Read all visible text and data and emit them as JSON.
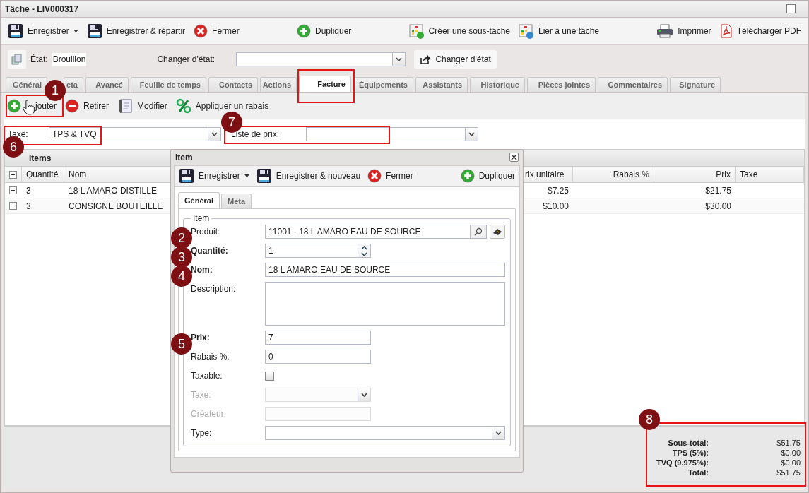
{
  "window": {
    "title": "Tâche - LIV000317"
  },
  "toolbar": [
    [
      {
        "kind": "save",
        "label": "Enregistrer",
        "dropdown": true
      },
      {
        "kind": "save-send",
        "label": "Enregistrer & répartir"
      },
      {
        "kind": "close",
        "label": "Fermer"
      }
    ],
    [
      {
        "kind": "duplicate",
        "label": "Dupliquer"
      }
    ],
    [
      {
        "kind": "subtask",
        "label": "Créer une sous-tâche"
      },
      {
        "kind": "link",
        "label": "Lier à une tâche"
      }
    ],
    [
      {
        "kind": "print",
        "label": "Imprimer"
      },
      {
        "kind": "pdf",
        "label": "Télécharger PDF"
      }
    ]
  ],
  "state": {
    "label": "État:",
    "value": "Brouillon",
    "change_label": "Changer d'état:",
    "change_button": "Changer d'état"
  },
  "tabs": [
    {
      "label": "Général",
      "selected": false
    },
    {
      "label": "eta",
      "selected": false
    },
    {
      "label": "Avancé",
      "selected": false
    },
    {
      "label": "Feuille de temps",
      "selected": false
    },
    {
      "label": "Contacts",
      "selected": false
    },
    {
      "label": "Actions",
      "selected": false
    },
    {
      "label": "Facture",
      "selected": true
    },
    {
      "label": "Équipements",
      "selected": false
    },
    {
      "label": "Assistants",
      "selected": false
    },
    {
      "label": "Historique",
      "selected": false
    },
    {
      "label": "Pièces jointes",
      "selected": false
    },
    {
      "label": "Commentaires",
      "selected": false
    },
    {
      "label": "Signature",
      "selected": false
    }
  ],
  "subtoolbar": [
    {
      "kind": "add",
      "label": "jouter"
    },
    {
      "kind": "remove",
      "label": "Retirer"
    },
    {
      "kind": "edit",
      "label": "Modifier"
    },
    {
      "kind": "discount",
      "label": "Appliquer un rabais"
    }
  ],
  "filters": {
    "tax_label": "Taxe:",
    "tax_value": "TPS & TVQ",
    "pricelist_label": "Liste de prix:"
  },
  "items": {
    "title": "Items",
    "columns": [
      "Quantité",
      "Nom",
      "rix unitaire",
      "Rabais %",
      "Prix",
      "Taxe"
    ],
    "rows": [
      {
        "quantity": "3",
        "name": "18 L AMARO DISTILLE",
        "unit_price": "$7.25",
        "price": "$21.75"
      },
      {
        "quantity": "3",
        "name": "CONSIGNE BOUTEILLE",
        "unit_price": "$10.00",
        "price": "$30.00"
      }
    ]
  },
  "totals": [
    {
      "label": "Sous-total:",
      "value": "$51.75"
    },
    {
      "label": "TPS (5%):",
      "value": "$0.00"
    },
    {
      "label": "TVQ (9.975%):",
      "value": "$0.00"
    },
    {
      "label": "Total:",
      "value": "$51.75"
    }
  ],
  "dialog": {
    "title": "Item",
    "toolbar": [
      {
        "kind": "save",
        "label": "Enregistrer",
        "dropdown": true
      },
      {
        "kind": "save",
        "label": "Enregistrer & nouveau"
      },
      {
        "kind": "close",
        "label": "Fermer"
      },
      {
        "kind": "duplicate",
        "label": "Dupliquer"
      }
    ],
    "tabs": [
      {
        "label": "Général",
        "selected": true
      },
      {
        "label": "Meta",
        "selected": false
      }
    ],
    "legend": "Item",
    "fields": [
      {
        "kind": "lookup",
        "label": "Produit:",
        "value": "11001 - 18 L AMARO EAU DE SOURCE",
        "required": false
      },
      {
        "kind": "spinner",
        "label": "Quantité:",
        "value": "1",
        "required": true
      },
      {
        "kind": "text",
        "label": "Nom:",
        "value": "18 L AMARO EAU DE SOURCE",
        "required": true,
        "wide": true
      },
      {
        "kind": "textarea",
        "label": "Description:",
        "required": false
      },
      {
        "kind": "text",
        "label": "Prix:",
        "value": "7",
        "required": true
      },
      {
        "kind": "text",
        "label": "Rabais %:",
        "value": "0",
        "required": false
      },
      {
        "kind": "checkbox",
        "label": "Taxable:",
        "checked": false,
        "required": false
      },
      {
        "kind": "select",
        "label": "Taxe:",
        "disabled": true,
        "required": false
      },
      {
        "kind": "text",
        "label": "Créateur:",
        "disabled": true,
        "required": false
      },
      {
        "kind": "select",
        "label": "Type:",
        "wide": true,
        "required": false
      }
    ]
  },
  "annotations": [
    {
      "number": "1"
    },
    {
      "number": "2"
    },
    {
      "number": "3"
    },
    {
      "number": "4"
    },
    {
      "number": "5"
    },
    {
      "number": "6"
    },
    {
      "number": "7"
    },
    {
      "number": "8"
    }
  ]
}
